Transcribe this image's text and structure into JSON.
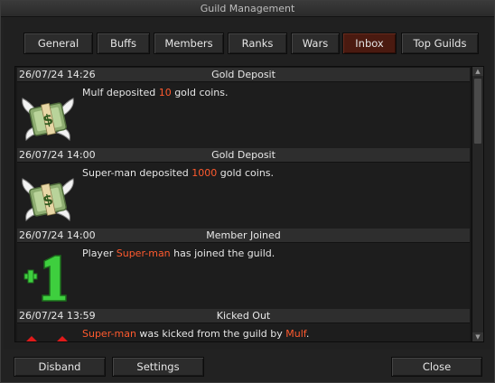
{
  "window": {
    "title": "Guild Management"
  },
  "tabs": [
    {
      "label": "General"
    },
    {
      "label": "Buffs"
    },
    {
      "label": "Members"
    },
    {
      "label": "Ranks"
    },
    {
      "label": "Wars"
    },
    {
      "label": "Inbox",
      "active": true
    },
    {
      "label": "Top Guilds"
    }
  ],
  "inbox": [
    {
      "time": "26/07/24 14:26",
      "type": "Gold Deposit",
      "icon": "money-wings-icon",
      "pre": "Mulf deposited ",
      "hl": "10",
      "post": " gold coins."
    },
    {
      "time": "26/07/24 14:00",
      "type": "Gold Deposit",
      "icon": "money-wings-icon",
      "pre": "Super-man deposited ",
      "hl": "1000",
      "post": " gold coins."
    },
    {
      "time": "26/07/24 14:00",
      "type": "Member Joined",
      "icon": "plus-one-icon",
      "pre": "Player ",
      "hl": "Super-man",
      "post": " has joined the guild."
    },
    {
      "time": "26/07/24 13:59",
      "type": "Kicked Out",
      "icon": "kick-icon",
      "hl1": "Super-man",
      "mid": " was kicked from the guild by ",
      "hl2": "Mulf",
      "end": "."
    }
  ],
  "buttons": {
    "disband": "Disband",
    "settings": "Settings",
    "close": "Close"
  },
  "colors": {
    "highlight": "#ff5a2e",
    "active_tab": "#4a1a10",
    "icon_green": "#3ecf3e",
    "icon_red": "#e01a1a"
  }
}
